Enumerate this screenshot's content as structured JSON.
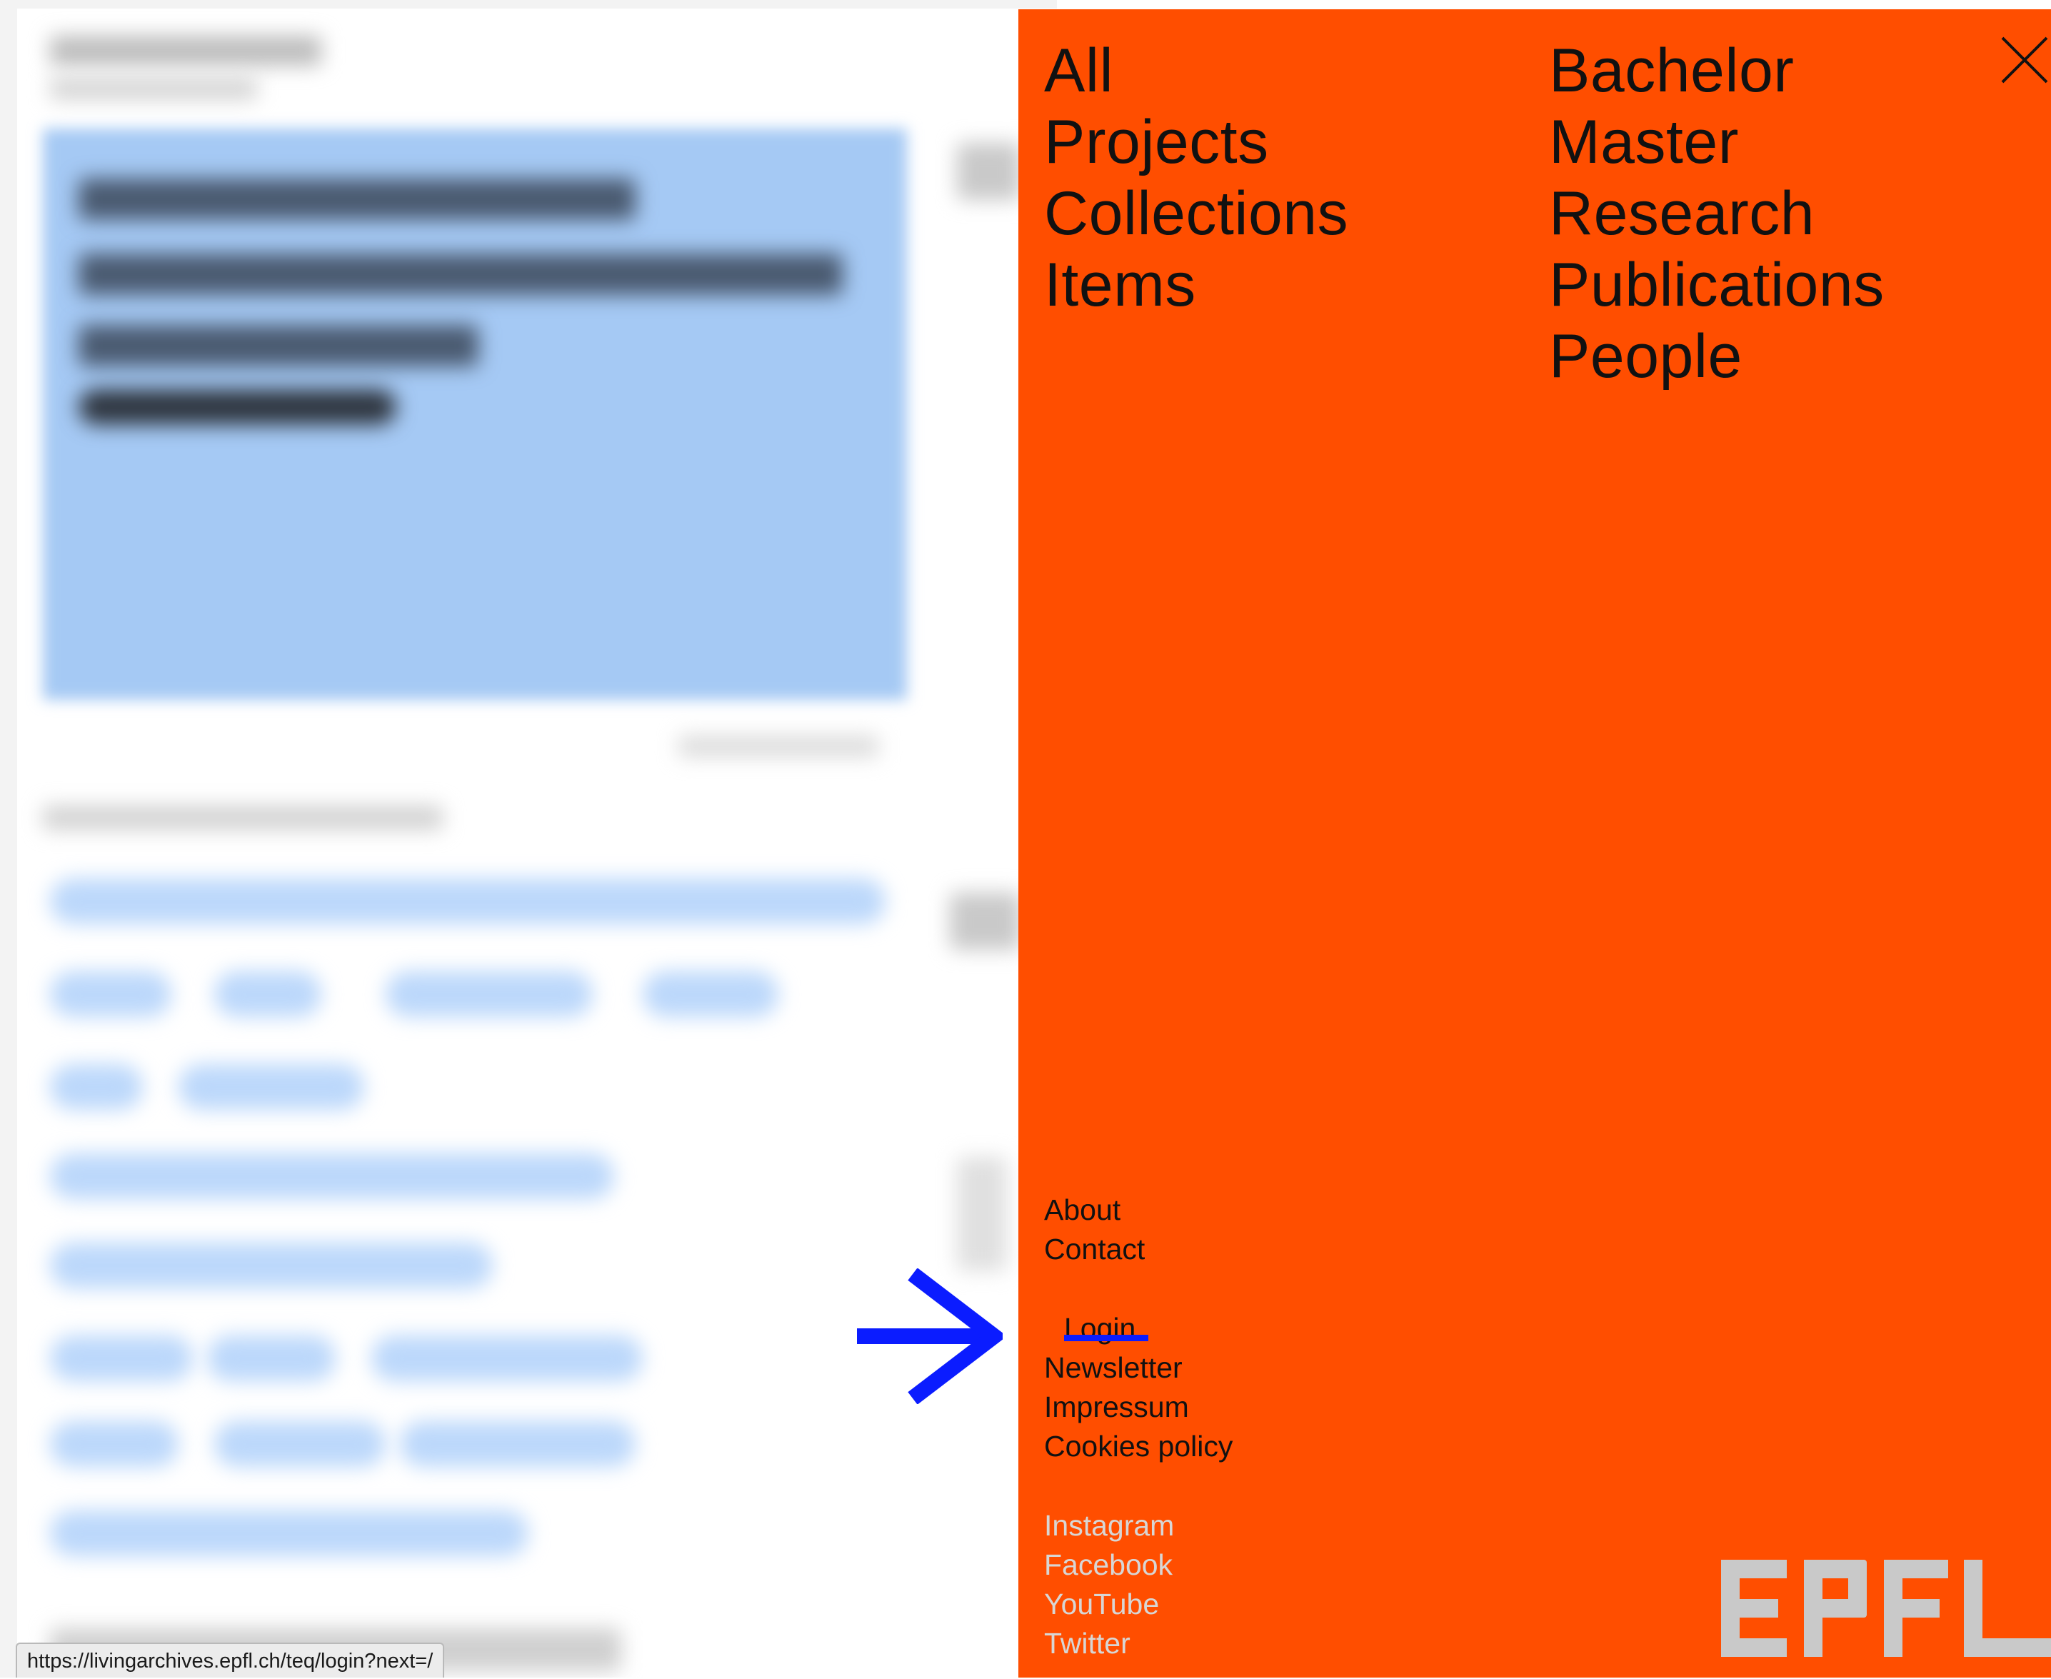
{
  "menu": {
    "primary_nav": [
      "All",
      "Projects",
      "Collections",
      "Items"
    ],
    "secondary_nav": [
      "Bachelor",
      "Master",
      "Research",
      "Publications",
      "People"
    ],
    "info_links": [
      "About",
      "Contact"
    ],
    "account_links": {
      "login": "Login",
      "newsletter": "Newsletter",
      "impressum": "Impressum",
      "cookies": "Cookies policy"
    },
    "social_links": [
      "Instagram",
      "Facebook",
      "YouTube",
      "Twitter"
    ],
    "logo_text": "EPFL"
  },
  "status_bar": {
    "url": "https://livingarchives.epfl.ch/teq/login?next=/"
  },
  "colors": {
    "menu_background": "#ff4e00",
    "menu_text": "#111111",
    "social_text": "#d8d6d4",
    "logo": "#c9c9c9",
    "annotation_blue": "#0b1cff",
    "background_hero": "#a5c9f4"
  },
  "icons": {
    "close": "close-x-icon",
    "annotation": "arrow-right-icon"
  }
}
